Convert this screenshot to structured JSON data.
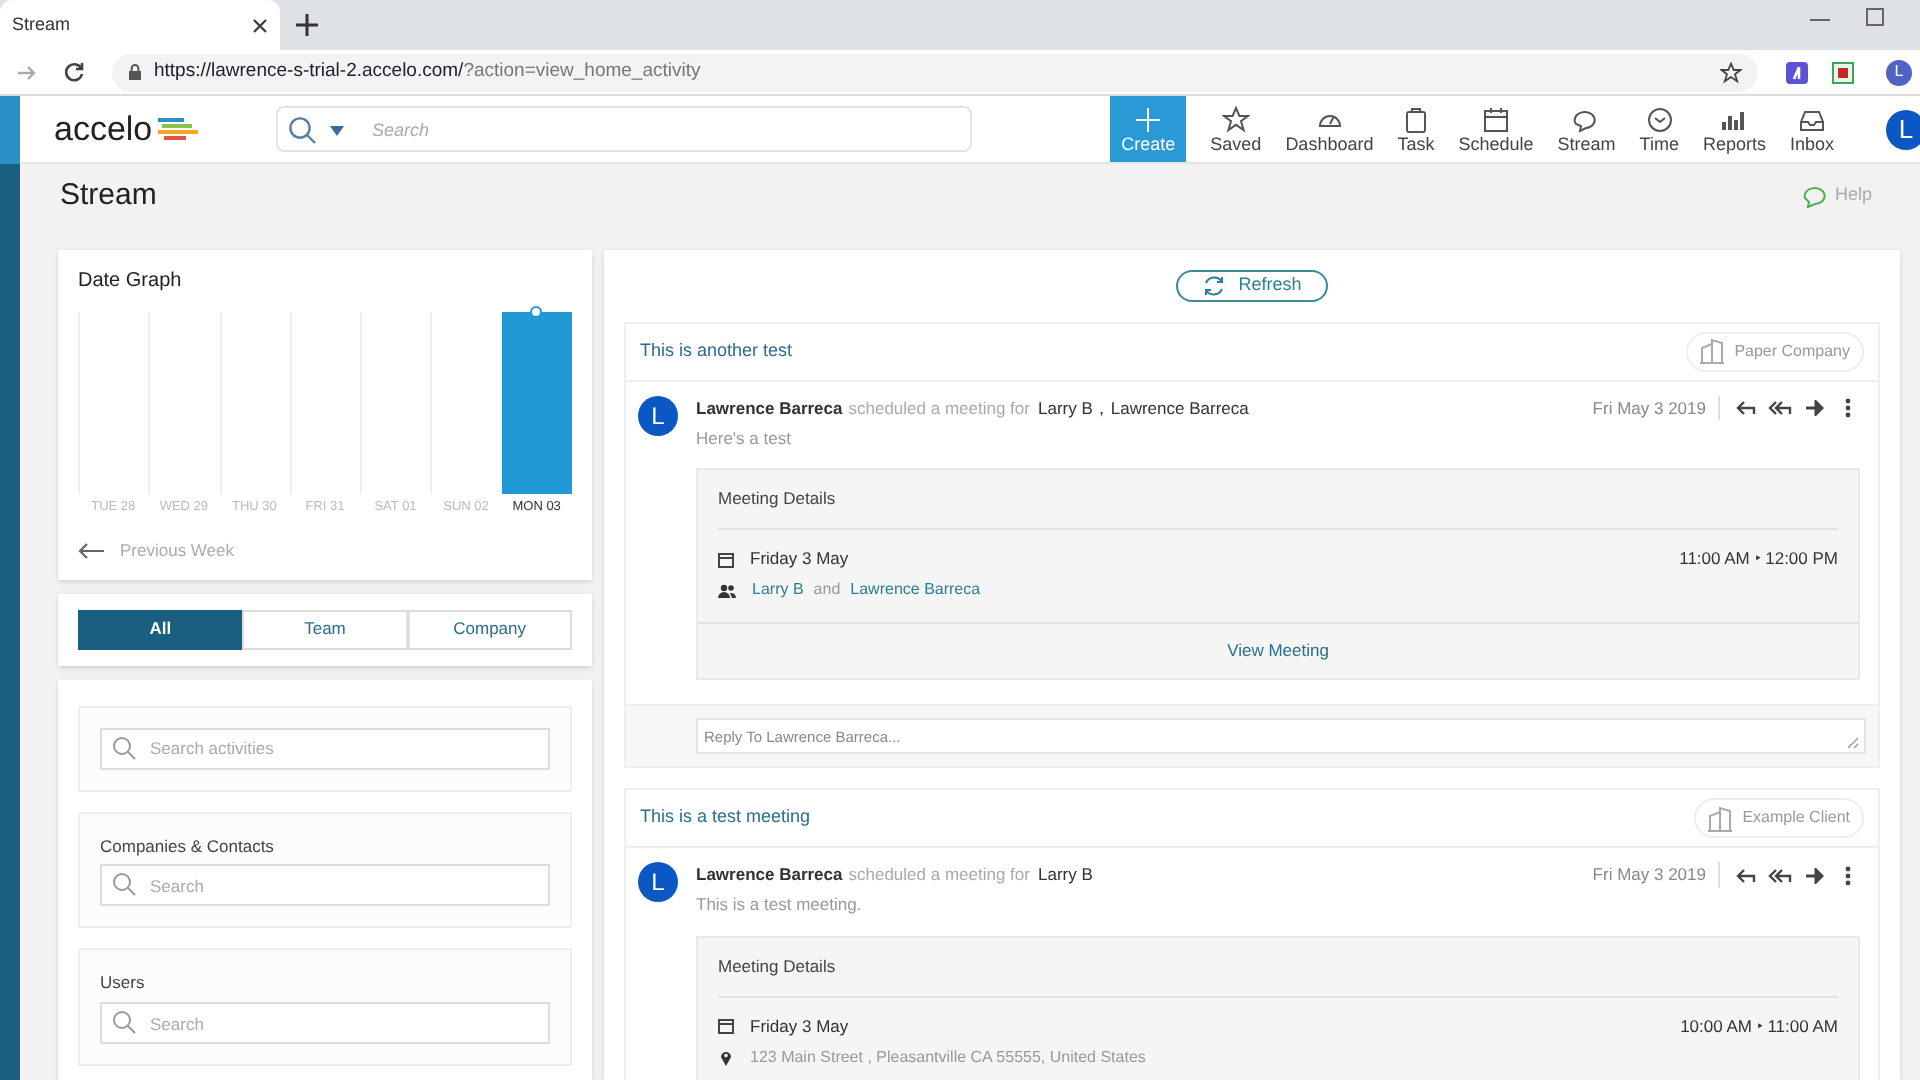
{
  "browser": {
    "tab_title": "Stream",
    "url_host": "https://lawrence-s-trial-2.accelo.com/",
    "url_path": "?action=view_home_activity",
    "profile_initial": "L"
  },
  "header": {
    "logo": "accelo",
    "search_placeholder": "Search",
    "avatar_initial": "L",
    "nav": [
      {
        "label": "Create",
        "selected": true
      },
      {
        "label": "Saved",
        "selected": false
      },
      {
        "label": "Dashboard",
        "selected": false
      },
      {
        "label": "Task",
        "selected": false
      },
      {
        "label": "Schedule",
        "selected": false
      },
      {
        "label": "Stream",
        "selected": false
      },
      {
        "label": "Time",
        "selected": false
      },
      {
        "label": "Reports",
        "selected": false
      },
      {
        "label": "Inbox",
        "selected": false
      }
    ]
  },
  "page": {
    "title": "Stream",
    "help": "Help"
  },
  "date_graph": {
    "title": "Date Graph",
    "previous": "Previous Week",
    "days": [
      {
        "label": "TUE 28",
        "selected": false
      },
      {
        "label": "WED 29",
        "selected": false
      },
      {
        "label": "THU 30",
        "selected": false
      },
      {
        "label": "FRI 31",
        "selected": false
      },
      {
        "label": "SAT 01",
        "selected": false
      },
      {
        "label": "SUN 02",
        "selected": false
      },
      {
        "label": "MON 03",
        "selected": true
      }
    ]
  },
  "scope_tabs": [
    {
      "label": "All",
      "selected": true
    },
    {
      "label": "Team",
      "selected": false
    },
    {
      "label": "Company",
      "selected": false
    }
  ],
  "filters": [
    {
      "placeholder": "Search activities"
    },
    {
      "label": "Companies & Contacts",
      "placeholder": "Search"
    },
    {
      "label": "Users",
      "placeholder": "Search"
    }
  ],
  "refresh": "Refresh",
  "activities": [
    {
      "title": "This is another test",
      "company": "Paper Company",
      "avatar": "L",
      "author": "Lawrence Barreca",
      "action": "scheduled a meeting for",
      "recipients": "Larry B，Lawrence Barreca",
      "date": "Fri May 3 2019",
      "note": "Here's a test",
      "details": {
        "heading": "Meeting Details",
        "day": "Friday 3 May",
        "time": "11:00 AM ‣ 12:00 PM",
        "kind": "attendees",
        "attendees": [
          "Larry B",
          "Lawrence Barreca"
        ],
        "joiner": "and",
        "link": "View Meeting"
      },
      "reply_placeholder": "Reply To Lawrence Barreca..."
    },
    {
      "title": "This is a test meeting",
      "company": "Example Client",
      "avatar": "L",
      "author": "Lawrence Barreca",
      "action": "scheduled a meeting for",
      "recipients": "Larry B",
      "date": "Fri May 3 2019",
      "note": "This is a test meeting.",
      "details": {
        "heading": "Meeting Details",
        "day": "Friday 3 May",
        "time": "10:00 AM ‣ 11:00 AM",
        "kind": "location",
        "location": "123 Main Street , Pleasantville CA 55555, United States"
      }
    }
  ]
}
